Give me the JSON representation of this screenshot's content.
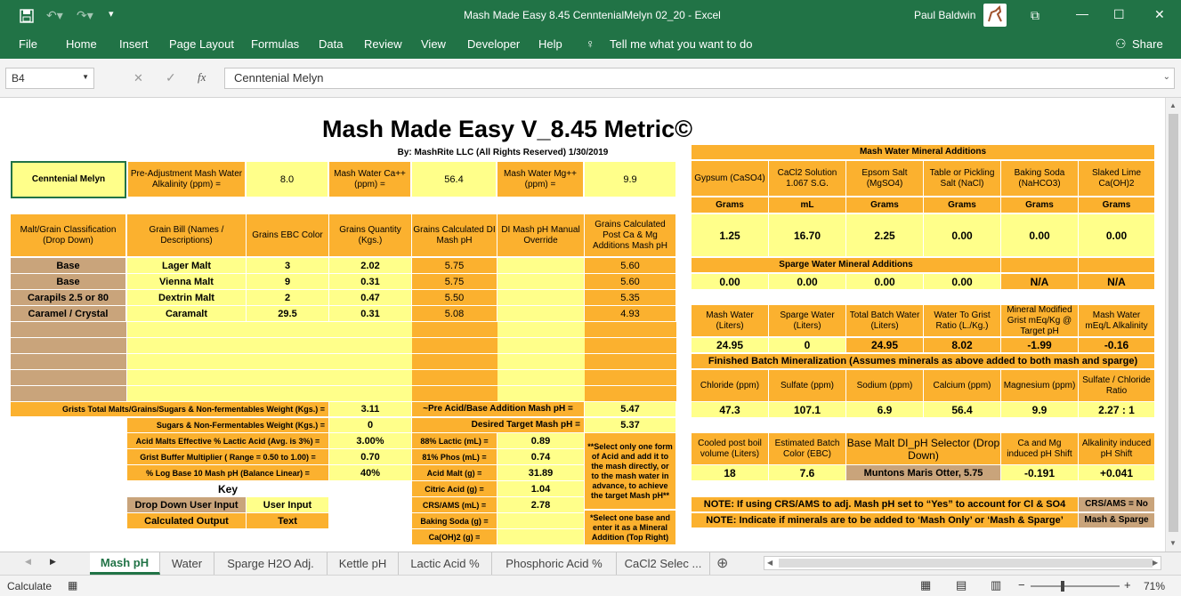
{
  "window": {
    "title": "Mash Made Easy 8.45 CenntenialMelyn 02_20  -  Excel",
    "user": "Paul Baldwin"
  },
  "menu": [
    "File",
    "Home",
    "Insert",
    "Page Layout",
    "Formulas",
    "Data",
    "Review",
    "View",
    "Developer",
    "Help",
    "Tell me what you want to do",
    "Share"
  ],
  "formula": {
    "namebox": "B4",
    "content": "Cenntenial Melyn",
    "fx": "fx",
    "cancel": "✕",
    "enter": "✓"
  },
  "sheet": {
    "title": "Mash Made Easy V_8.45 Metric©",
    "byline": "By: MashRite LLC (All Rights Reserved) 1/30/2019",
    "recipe_name": "Cenntenial Melyn",
    "top": {
      "alk_label": "Pre-Adjustment Mash Water Alkalinity (ppm) =",
      "alk": "8.0",
      "ca_label": "Mash Water Ca++ (ppm)  =",
      "ca": "56.4",
      "mg_label": "Mash Water Mg++ (ppm)  =",
      "mg": "9.9"
    },
    "grain_headers": [
      "Malt/Grain Classification (Drop Down)",
      "Grain Bill (Names / Descriptions)",
      "Grains EBC Color",
      "Grains Quantity (Kgs.)",
      "Grains Calculated DI Mash pH",
      "DI Mash pH Manual Override",
      "Grains Calculated Post  Ca & Mg Additions Mash pH"
    ],
    "grains": [
      {
        "cls": "Base",
        "name": "Lager Malt",
        "ebc": "3",
        "qty": "2.02",
        "di": "5.75",
        "post": "5.60"
      },
      {
        "cls": "Base",
        "name": "Vienna Malt",
        "ebc": "9",
        "qty": "0.31",
        "di": "5.75",
        "post": "5.60"
      },
      {
        "cls": "Carapils 2.5 or 80",
        "name": "Dextrin Malt",
        "ebc": "2",
        "qty": "0.47",
        "di": "5.50",
        "post": "5.35"
      },
      {
        "cls": "Caramel / Crystal",
        "name": "Caramalt",
        "ebc": "29.5",
        "qty": "0.31",
        "di": "5.08",
        "post": "4.93"
      }
    ],
    "totals": {
      "grist_label": "Grists Total Malts/Grains/Sugars & Non-fermentables Weight (Kgs.) =",
      "grist": "3.11",
      "pre_label": "~Pre Acid/Base Addition Mash pH =",
      "pre": "5.47",
      "sugar_label": "Sugars & Non-Fermentables Weight (Kgs.) =",
      "sugar": "0",
      "target_label": "Desired Target Mash pH =",
      "target": "5.37"
    },
    "acid": {
      "lactic_pct_label": "Acid Malts Effective % Lactic Acid (Avg. is 3%) =",
      "lactic_pct": "3.00%",
      "buffer_label": "Grist Buffer Multiplier ( Range = 0.50 to 1.00) =",
      "buffer": "0.70",
      "log_label": "% Log Base 10 Mash pH (Balance Linear) =",
      "log": "40%",
      "items": [
        {
          "label": "88%  Lactic (mL) =",
          "value": "0.89"
        },
        {
          "label": "81%  Phos  (mL) =",
          "value": "0.74"
        },
        {
          "label": "Acid Malt (g)  =",
          "value": "31.89"
        },
        {
          "label": "Citric Acid (g) =",
          "value": "1.04"
        },
        {
          "label": "CRS/AMS (mL) =",
          "value": "2.78"
        },
        {
          "label": "Baking Soda (g) =",
          "value": ""
        },
        {
          "label": "Ca(OH)2 (g) =",
          "value": ""
        }
      ],
      "note1": "**Select only one form of Acid and add it to the mash directly, or to the mash water in advance, to achieve the target Mash pH**",
      "note2": "*Select one base and enter it as a Mineral Addition (Top Right)"
    },
    "key": {
      "title": "Key",
      "dropdown": "Drop Down User Input",
      "user": "User Input",
      "calc": "Calculated Output",
      "text": "Text"
    },
    "mash_minerals": {
      "title": "Mash Water Mineral Additions",
      "headers": [
        "Gypsum (CaSO4)",
        "CaCl2 Solution 1.067 S.G.",
        "Epsom Salt (MgSO4)",
        "Table or Pickling Salt (NaCl)",
        "Baking Soda (NaHCO3)",
        "Slaked Lime Ca(OH)2"
      ],
      "units": [
        "Grams",
        "mL",
        "Grams",
        "Grams",
        "Grams",
        "Grams"
      ],
      "values": [
        "1.25",
        "16.70",
        "2.25",
        "0.00",
        "0.00",
        "0.00"
      ]
    },
    "sparge_minerals": {
      "title": "Sparge Water Mineral Additions",
      "values": [
        "0.00",
        "0.00",
        "0.00",
        "0.00",
        "N/A",
        "N/A"
      ]
    },
    "volumes": {
      "headers": [
        "Mash Water (Liters)",
        "Sparge Water (Liters)",
        "Total Batch Water (Liters)",
        "Water To Grist Ratio (L./Kg.)",
        "Mineral Modified Grist mEq/Kg @ Target pH",
        "Mash Water mEq/L Alkalinity"
      ],
      "values": [
        "24.95",
        "0",
        "24.95",
        "8.02",
        "-1.99",
        "-0.16"
      ]
    },
    "finished": {
      "title": "Finished Batch Mineralization (Assumes minerals as above added to both mash and sparge)",
      "headers": [
        "Chloride (ppm)",
        "Sulfate (ppm)",
        "Sodium (ppm)",
        "Calcium (ppm)",
        "Magnesium (ppm)",
        "Sulfate / Chloride Ratio"
      ],
      "values": [
        "47.3",
        "107.1",
        "6.9",
        "56.4",
        "9.9",
        "2.27 : 1"
      ]
    },
    "bottom": {
      "cooled_label": "Cooled post boil volume (Liters)",
      "cooled": "18",
      "ebc_label": "Estimated Batch Color (EBC)",
      "ebc": "7.6",
      "base_label": "Base Malt DI_pH Selector (Drop Down)",
      "base": "Muntons Maris Otter, 5.75",
      "shift_label": "Ca and Mg induced pH Shift",
      "shift": "-0.191",
      "alk_label": "Alkalinity induced pH Shift",
      "alk": "+0.041"
    },
    "notes": {
      "n1": "NOTE: If using CRS/AMS to adj. Mash pH set to “Yes” to account for Cl & SO4",
      "n1v": "CRS/AMS = No",
      "n2": "NOTE: Indicate if minerals are to be added to ‘Mash Only’ or ‘Mash & Sparge’",
      "n2v": "Mash & Sparge"
    }
  },
  "tabs": [
    "Mash pH",
    "Water",
    "Sparge H2O Adj.",
    "Kettle pH",
    "Lactic Acid %",
    "Phosphoric Acid %",
    "CaCl2 Selec  ..."
  ],
  "status": {
    "mode": "Calculate",
    "zoom": "71%"
  }
}
